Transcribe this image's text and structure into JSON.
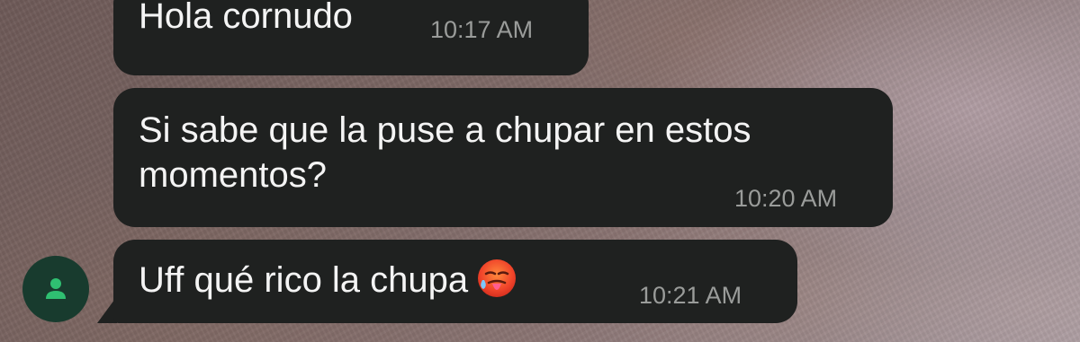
{
  "messages": [
    {
      "text": "Hola cornudo",
      "time": "10:17 AM"
    },
    {
      "text": "Si sabe que la puse a chupar en estos momentos?",
      "time": "10:20 AM"
    },
    {
      "text": "Uff qué rico la chupa",
      "time": "10:21 AM",
      "emoji": "hot-face-emoji"
    }
  ],
  "avatar": {
    "icon": "user-silhouette-icon",
    "color": "#183b2e",
    "icon_color": "#2fbf71"
  },
  "colors": {
    "bubble": "#1f2120",
    "text": "#f4f4f4",
    "timestamp": "#9a9c9a"
  }
}
